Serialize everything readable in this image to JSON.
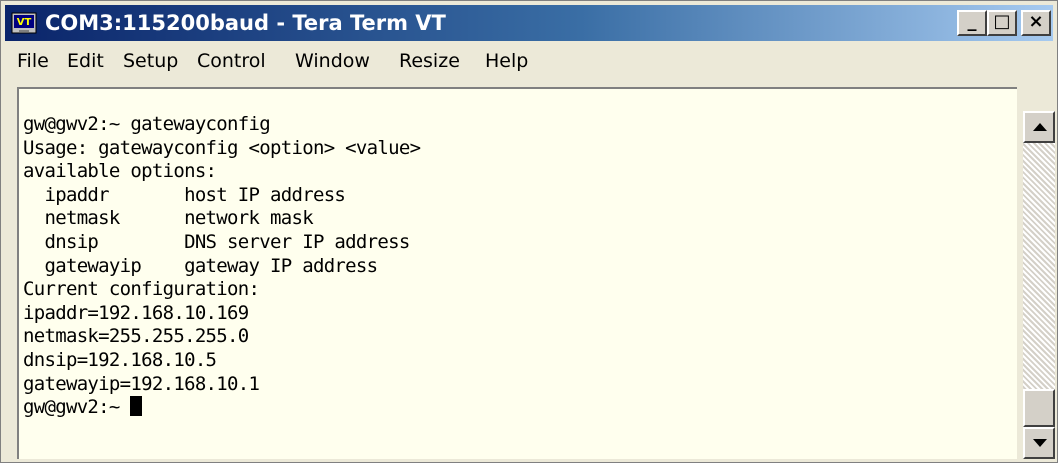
{
  "window": {
    "title": "COM3:115200baud - Tera Term VT",
    "controls": {
      "minimize": "_",
      "maximize": "□",
      "close": "×"
    }
  },
  "menu": {
    "items": [
      "File",
      "Edit",
      "Setup",
      "Control",
      "Window",
      "Resize",
      "Help"
    ]
  },
  "terminal": {
    "lines": [
      "gw@gwv2:~ gatewayconfig",
      "Usage: gatewayconfig <option> <value>",
      "available options:",
      "  ipaddr       host IP address",
      "  netmask      network mask",
      "  dnsip        DNS server IP address",
      "  gatewayip    gateway IP address",
      "Current configuration:",
      "ipaddr=192.168.10.169",
      "netmask=255.255.255.0",
      "dnsip=192.168.10.5",
      "gatewayip=192.168.10.1"
    ],
    "prompt": "gw@gwv2:~ "
  },
  "colors": {
    "terminal_background": "#ffffee",
    "title_gradient_start": "#0a246a",
    "title_gradient_end": "#a6caf0"
  },
  "icons": {
    "app": "tera-term-icon"
  }
}
